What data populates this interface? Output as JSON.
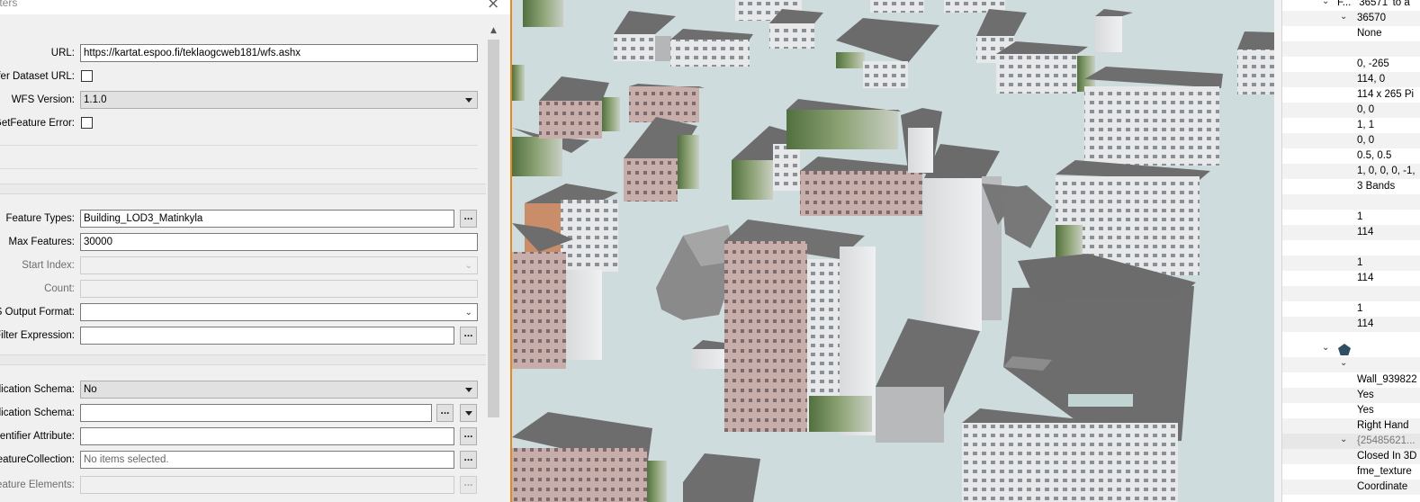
{
  "dialog": {
    "title_fragment": "neters",
    "close_label": "×",
    "rows": {
      "url": {
        "label": "URL:",
        "value": "https://kartat.espoo.fi/teklaogcweb181/wfs.ashx"
      },
      "prefer_url": {
        "label": "efer Dataset URL:",
        "checked": false
      },
      "wfs_version": {
        "label": "WFS Version:",
        "value": "1.1.0"
      },
      "getfeature_error": {
        "label": "GetFeature Error:",
        "checked": false
      },
      "feature_types": {
        "label": "Feature Types:",
        "value": "Building_LOD3_Matinkyla",
        "button": "..."
      },
      "max_features": {
        "label": "Max Features:",
        "value": "30000"
      },
      "start_index": {
        "label": "Start Index:",
        "value": ""
      },
      "count": {
        "label": "Count:",
        "value": ""
      },
      "output_format": {
        "label": "S Output Format:",
        "value": ""
      },
      "filter_expression": {
        "label": "Filter Expression:",
        "value": "",
        "button": "..."
      },
      "app_schema_1": {
        "label": "plication Schema:",
        "value": "No"
      },
      "app_schema_2": {
        "label": "plication Schema:",
        "value": "",
        "button": "..."
      },
      "identifier": {
        "label": "entifier Attribute:",
        "value": "",
        "button": "..."
      },
      "feature_collection": {
        "label": "FeatureCollection:",
        "placeholder": "No items selected.",
        "button": "..."
      },
      "feature_elements": {
        "label": "Feature Elements:",
        "value": "",
        "button": "..."
      }
    },
    "scroll_up": "▲"
  },
  "info_panel": {
    "rows": [
      {
        "text": "'36571' to a",
        "prefix": "F...",
        "toggle": "⌄",
        "style": "top"
      },
      {
        "text": "36570",
        "toggle": "⌄"
      },
      {
        "text": "None"
      },
      {
        "text": ""
      },
      {
        "text": "0, -265"
      },
      {
        "text": "114, 0"
      },
      {
        "text": "114 x 265 Pi"
      },
      {
        "text": "0, 0"
      },
      {
        "text": "1, 1"
      },
      {
        "text": "0, 0"
      },
      {
        "text": "0.5, 0.5"
      },
      {
        "text": "1, 0, 0, 0, -1,"
      },
      {
        "text": "3 Bands"
      },
      {
        "text": ""
      },
      {
        "text": "1"
      },
      {
        "text": "114"
      },
      {
        "text": ""
      },
      {
        "text": "1"
      },
      {
        "text": "114"
      },
      {
        "text": ""
      },
      {
        "text": "1"
      },
      {
        "text": "114"
      },
      {
        "text": "",
        "icon": "pentagon-icon",
        "toggle": "⌄"
      },
      {
        "text": "",
        "toggle": "⌄"
      },
      {
        "text": "Wall_939822"
      },
      {
        "text": "Yes"
      },
      {
        "text": "Yes"
      },
      {
        "text": "Right Hand"
      },
      {
        "text": "{25485621...",
        "toggle": "⌄",
        "gray": true
      },
      {
        "text": "Closed In 3D"
      },
      {
        "text": "fme_texture"
      },
      {
        "text": "Coordinate"
      }
    ]
  },
  "colors": {
    "viewport_ground": "#cfdcde",
    "viewport_border": "#e58a1f",
    "roof": "#6e6e6e",
    "dialog_bg": "#f0f0f0"
  }
}
